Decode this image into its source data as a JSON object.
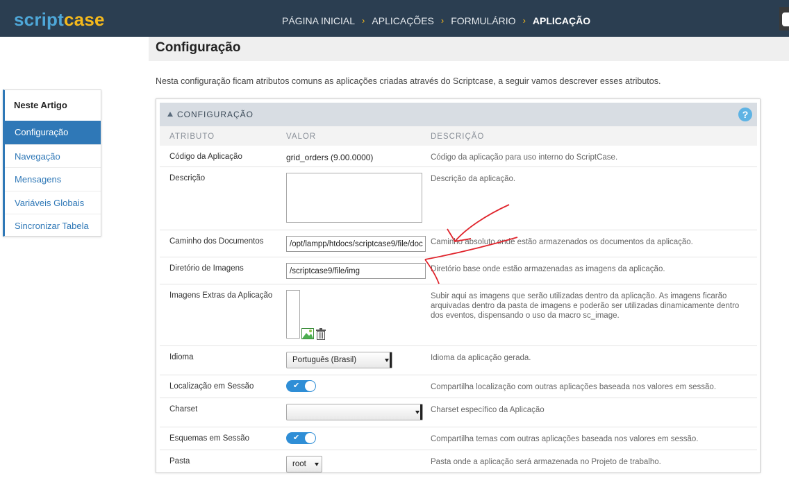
{
  "brand": {
    "part1": "script",
    "part2": "case"
  },
  "breadcrumb": [
    {
      "label": "PÁGINA INICIAL"
    },
    {
      "label": "APLICAÇÕES"
    },
    {
      "label": "FORMULÁRIO"
    },
    {
      "label": "APLICAÇÃO"
    }
  ],
  "page": {
    "title": "Configuração",
    "intro": "Nesta configuração ficam atributos comuns as aplicações criadas através do Scriptcase, a seguir vamos descrever esses atributos."
  },
  "sidebar": {
    "heading": "Neste Artigo",
    "items": [
      {
        "label": "Configuração",
        "active": true
      },
      {
        "label": "Navegação"
      },
      {
        "label": "Mensagens"
      },
      {
        "label": "Variáveis Globais"
      },
      {
        "label": "Sincronizar Tabela"
      }
    ]
  },
  "panel": {
    "title": "CONFIGURAÇÃO",
    "help": "?",
    "columns": {
      "attr": "ATRIBUTO",
      "value": "VALOR",
      "desc": "DESCRIÇÃO"
    },
    "rows": [
      {
        "attr": "Código da Aplicação",
        "value": "grid_orders (9.00.0000)",
        "desc": "Código da aplicação para uso interno do ScriptCase."
      },
      {
        "attr": "Descrição",
        "value": "",
        "desc": "Descrição da aplicação."
      },
      {
        "attr": "Caminho dos Documentos",
        "value": "/opt/lampp/htdocs/scriptcase9/file/doc",
        "desc": "Caminho absoluto onde estão armazenados os documentos da aplicação."
      },
      {
        "attr": "Diretório de Imagens",
        "value": "/scriptcase9/file/img",
        "desc": "Diretório base onde estão armazenadas as imagens da aplicação."
      },
      {
        "attr": "Imagens Extras da Aplicação",
        "value": "",
        "desc": "Subir aqui as imagens que serão utilizadas dentro da aplicação. As imagens ficarão arquivadas dentro da pasta de imagens e poderão ser utilizadas dinamicamente dentro dos eventos, dispensando o uso da macro sc_image."
      },
      {
        "attr": "Idioma",
        "value": "Português (Brasil)",
        "desc": "Idioma da aplicação gerada."
      },
      {
        "attr": "Localização em Sessão",
        "value": "✔",
        "desc": "Compartilha localização com outras aplicações baseada nos valores em sessão."
      },
      {
        "attr": "Charset",
        "value": "",
        "desc": "Charset específico da Aplicação"
      },
      {
        "attr": "Esquemas em Sessão",
        "value": "✔",
        "desc": "Compartilha temas com outras aplicações baseada nos valores em sessão."
      },
      {
        "attr": "Pasta",
        "value": "root",
        "desc": "Pasta onde a aplicação será armazenada no Projeto de trabalho."
      }
    ]
  },
  "colors": {
    "topbar": "#2b3e51",
    "accent": "#2f78b7",
    "brand_yellow": "#f5b91c",
    "annotation": "#e0242c"
  }
}
